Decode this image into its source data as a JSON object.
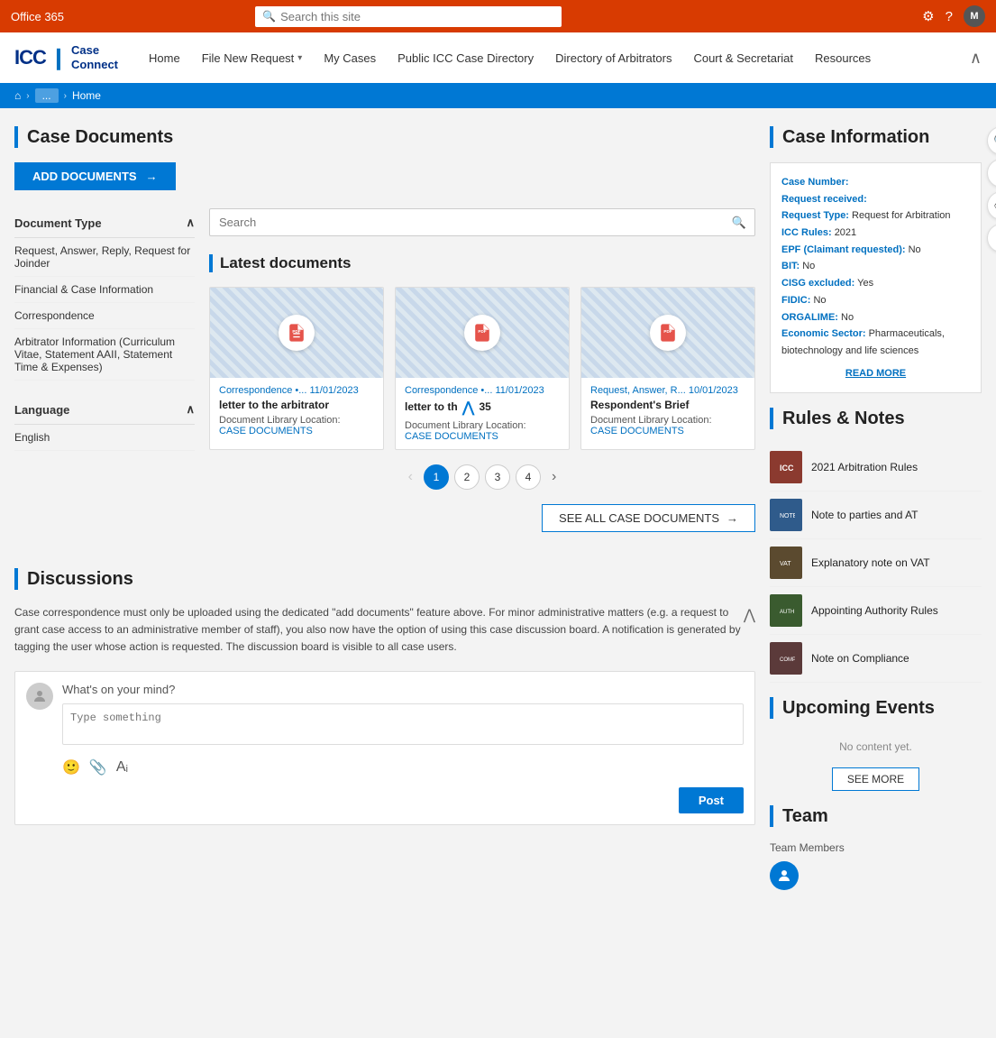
{
  "topbar": {
    "office365": "Office 365",
    "search_placeholder": "Search this site",
    "avatar_label": "M"
  },
  "navbar": {
    "logo_icc": "ICC",
    "logo_case_connect": "Case\nConnect",
    "nav_items": [
      {
        "label": "Home",
        "has_chevron": false
      },
      {
        "label": "File New Request",
        "has_chevron": true
      },
      {
        "label": "My Cases",
        "has_chevron": false
      },
      {
        "label": "Public ICC Case Directory",
        "has_chevron": false
      },
      {
        "label": "Directory of Arbitrators",
        "has_chevron": false
      },
      {
        "label": "Court & Secretariat",
        "has_chevron": false
      },
      {
        "label": "Resources",
        "has_chevron": false
      }
    ]
  },
  "breadcrumb": {
    "home_icon": "⌂",
    "middle_item": "...",
    "current": "Home"
  },
  "case_documents": {
    "title": "Case Documents",
    "add_btn": "ADD DOCUMENTS",
    "search_placeholder": "Search",
    "filter_sections": [
      {
        "label": "Document Type",
        "items": [
          "Request, Answer, Reply, Request for Joinder",
          "Financial & Case Information",
          "Correspondence",
          "Arbitrator Information (Curriculum Vitae, Statement AAII, Statement Time & Expenses)"
        ]
      },
      {
        "label": "Language",
        "items": [
          "English"
        ]
      }
    ],
    "latest_docs_title": "Latest documents",
    "docs": [
      {
        "type": "Correspondence •... 11/01/2023",
        "title": "letter to the arbitrator",
        "location_label": "Document Library Location:",
        "location_link": "CASE DOCUMENTS"
      },
      {
        "type": "Correspondence •... 11/01/2023",
        "title": "letter to th",
        "has_expand": true,
        "expand_suffix": "35",
        "location_label": "Document Library Location:",
        "location_link": "CASE DOCUMENTS"
      },
      {
        "type": "Request, Answer, R... 10/01/2023",
        "title": "Respondent's Brief",
        "location_label": "Document Library Location:",
        "location_link": "CASE DOCUMENTS"
      }
    ],
    "pagination": [
      1,
      2,
      3,
      4
    ],
    "current_page": 1,
    "see_all_btn": "SEE ALL CASE DOCUMENTS"
  },
  "discussions": {
    "title": "Discussions",
    "body_text": "Case correspondence must only be uploaded using the dedicated \"add documents\" feature above. For minor administrative matters (e.g. a request to grant case access to an administrative member of staff), you also now have the option of using this case discussion board. A notification is generated by tagging the user whose action is requested. The discussion board is visible to all case users.",
    "whats_on_mind": "What's on your mind?",
    "type_something": "Type something",
    "post_btn": "Post"
  },
  "case_info": {
    "title": "Case Information",
    "case_number_label": "Case Number:",
    "request_received_label": "Request received:",
    "request_type_label": "Request Type:",
    "request_type_val": "Request for Arbitration",
    "icc_rules_label": "ICC Rules:",
    "icc_rules_val": "2021",
    "epf_label": "EPF (Claimant requested):",
    "epf_val": "No",
    "bit_label": "BIT:",
    "bit_val": "No",
    "cisg_label": "CISG excluded:",
    "cisg_val": "Yes",
    "fidic_label": "FIDIC:",
    "fidic_val": "No",
    "orgalime_label": "ORGALIME:",
    "orgalime_val": "No",
    "economic_label": "Economic Sector:",
    "economic_val": "Pharmaceuticals, biotechnology and life sciences",
    "read_more": "READ MORE"
  },
  "rules_notes": {
    "title": "Rules & Notes",
    "items": [
      {
        "label": "2021 Arbitration Rules",
        "color": "#8B3A2F"
      },
      {
        "label": "Note to parties and AT",
        "color": "#2F5B8B"
      },
      {
        "label": "Explanatory note on VAT",
        "color": "#5B4A2F"
      },
      {
        "label": "Appointing Authority Rules",
        "color": "#3A5B2F"
      },
      {
        "label": "Note on Compliance",
        "color": "#5B3A3A"
      }
    ]
  },
  "upcoming_events": {
    "title": "Upcoming Events",
    "no_content": "No content yet.",
    "see_more": "SEE MORE"
  },
  "team": {
    "title": "Team",
    "members_label": "Team Members"
  },
  "floating": {
    "search": "🔍",
    "star": "☆",
    "eye": "👁",
    "gear": "⚙"
  }
}
